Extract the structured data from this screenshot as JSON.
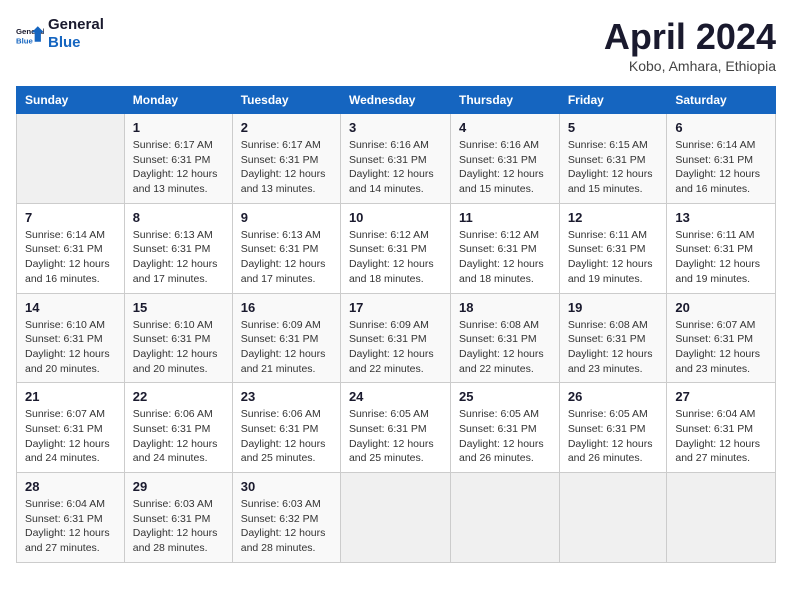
{
  "header": {
    "logo_line1": "General",
    "logo_line2": "Blue",
    "month_title": "April 2024",
    "subtitle": "Kobo, Amhara, Ethiopia"
  },
  "weekdays": [
    "Sunday",
    "Monday",
    "Tuesday",
    "Wednesday",
    "Thursday",
    "Friday",
    "Saturday"
  ],
  "weeks": [
    [
      {
        "day": "",
        "info": ""
      },
      {
        "day": "1",
        "info": "Sunrise: 6:17 AM\nSunset: 6:31 PM\nDaylight: 12 hours\nand 13 minutes."
      },
      {
        "day": "2",
        "info": "Sunrise: 6:17 AM\nSunset: 6:31 PM\nDaylight: 12 hours\nand 13 minutes."
      },
      {
        "day": "3",
        "info": "Sunrise: 6:16 AM\nSunset: 6:31 PM\nDaylight: 12 hours\nand 14 minutes."
      },
      {
        "day": "4",
        "info": "Sunrise: 6:16 AM\nSunset: 6:31 PM\nDaylight: 12 hours\nand 15 minutes."
      },
      {
        "day": "5",
        "info": "Sunrise: 6:15 AM\nSunset: 6:31 PM\nDaylight: 12 hours\nand 15 minutes."
      },
      {
        "day": "6",
        "info": "Sunrise: 6:14 AM\nSunset: 6:31 PM\nDaylight: 12 hours\nand 16 minutes."
      }
    ],
    [
      {
        "day": "7",
        "info": "Sunrise: 6:14 AM\nSunset: 6:31 PM\nDaylight: 12 hours\nand 16 minutes."
      },
      {
        "day": "8",
        "info": "Sunrise: 6:13 AM\nSunset: 6:31 PM\nDaylight: 12 hours\nand 17 minutes."
      },
      {
        "day": "9",
        "info": "Sunrise: 6:13 AM\nSunset: 6:31 PM\nDaylight: 12 hours\nand 17 minutes."
      },
      {
        "day": "10",
        "info": "Sunrise: 6:12 AM\nSunset: 6:31 PM\nDaylight: 12 hours\nand 18 minutes."
      },
      {
        "day": "11",
        "info": "Sunrise: 6:12 AM\nSunset: 6:31 PM\nDaylight: 12 hours\nand 18 minutes."
      },
      {
        "day": "12",
        "info": "Sunrise: 6:11 AM\nSunset: 6:31 PM\nDaylight: 12 hours\nand 19 minutes."
      },
      {
        "day": "13",
        "info": "Sunrise: 6:11 AM\nSunset: 6:31 PM\nDaylight: 12 hours\nand 19 minutes."
      }
    ],
    [
      {
        "day": "14",
        "info": "Sunrise: 6:10 AM\nSunset: 6:31 PM\nDaylight: 12 hours\nand 20 minutes."
      },
      {
        "day": "15",
        "info": "Sunrise: 6:10 AM\nSunset: 6:31 PM\nDaylight: 12 hours\nand 20 minutes."
      },
      {
        "day": "16",
        "info": "Sunrise: 6:09 AM\nSunset: 6:31 PM\nDaylight: 12 hours\nand 21 minutes."
      },
      {
        "day": "17",
        "info": "Sunrise: 6:09 AM\nSunset: 6:31 PM\nDaylight: 12 hours\nand 22 minutes."
      },
      {
        "day": "18",
        "info": "Sunrise: 6:08 AM\nSunset: 6:31 PM\nDaylight: 12 hours\nand 22 minutes."
      },
      {
        "day": "19",
        "info": "Sunrise: 6:08 AM\nSunset: 6:31 PM\nDaylight: 12 hours\nand 23 minutes."
      },
      {
        "day": "20",
        "info": "Sunrise: 6:07 AM\nSunset: 6:31 PM\nDaylight: 12 hours\nand 23 minutes."
      }
    ],
    [
      {
        "day": "21",
        "info": "Sunrise: 6:07 AM\nSunset: 6:31 PM\nDaylight: 12 hours\nand 24 minutes."
      },
      {
        "day": "22",
        "info": "Sunrise: 6:06 AM\nSunset: 6:31 PM\nDaylight: 12 hours\nand 24 minutes."
      },
      {
        "day": "23",
        "info": "Sunrise: 6:06 AM\nSunset: 6:31 PM\nDaylight: 12 hours\nand 25 minutes."
      },
      {
        "day": "24",
        "info": "Sunrise: 6:05 AM\nSunset: 6:31 PM\nDaylight: 12 hours\nand 25 minutes."
      },
      {
        "day": "25",
        "info": "Sunrise: 6:05 AM\nSunset: 6:31 PM\nDaylight: 12 hours\nand 26 minutes."
      },
      {
        "day": "26",
        "info": "Sunrise: 6:05 AM\nSunset: 6:31 PM\nDaylight: 12 hours\nand 26 minutes."
      },
      {
        "day": "27",
        "info": "Sunrise: 6:04 AM\nSunset: 6:31 PM\nDaylight: 12 hours\nand 27 minutes."
      }
    ],
    [
      {
        "day": "28",
        "info": "Sunrise: 6:04 AM\nSunset: 6:31 PM\nDaylight: 12 hours\nand 27 minutes."
      },
      {
        "day": "29",
        "info": "Sunrise: 6:03 AM\nSunset: 6:31 PM\nDaylight: 12 hours\nand 28 minutes."
      },
      {
        "day": "30",
        "info": "Sunrise: 6:03 AM\nSunset: 6:32 PM\nDaylight: 12 hours\nand 28 minutes."
      },
      {
        "day": "",
        "info": ""
      },
      {
        "day": "",
        "info": ""
      },
      {
        "day": "",
        "info": ""
      },
      {
        "day": "",
        "info": ""
      }
    ]
  ]
}
